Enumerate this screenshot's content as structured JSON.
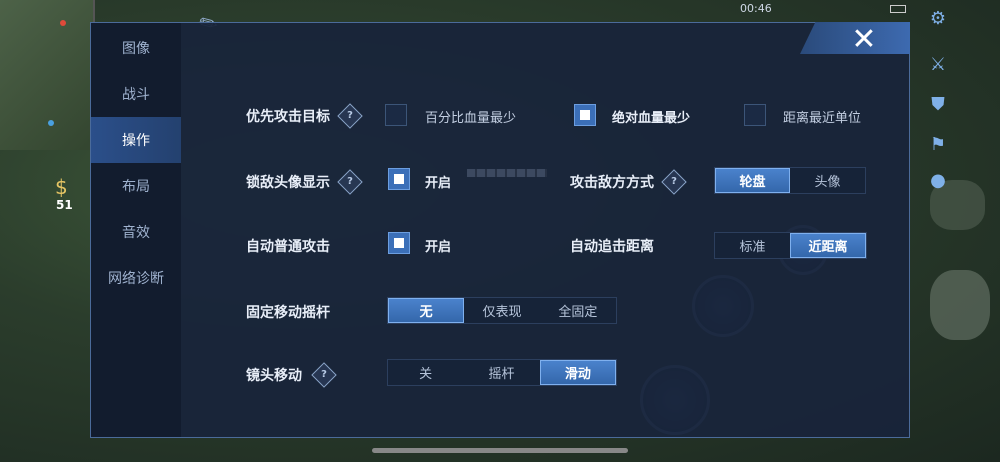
{
  "status": {
    "time": "00:46"
  },
  "hud": {
    "gold": "51"
  },
  "sidebar": {
    "items": [
      {
        "label": "图像"
      },
      {
        "label": "战斗"
      },
      {
        "label": "操作"
      },
      {
        "label": "布局"
      },
      {
        "label": "音效"
      },
      {
        "label": "网络诊断"
      }
    ],
    "active_index": 2
  },
  "close_icon": "close-icon",
  "settings": {
    "target_priority": {
      "label": "优先攻击目标",
      "options": [
        {
          "text": "百分比血量最少",
          "checked": false
        },
        {
          "text": "绝对血量最少",
          "checked": true
        },
        {
          "text": "距离最近单位",
          "checked": false
        }
      ]
    },
    "lock_avatar": {
      "label": "锁敌头像显示",
      "option": "开启",
      "checked": true
    },
    "attack_mode": {
      "label": "攻击敌方方式",
      "options": [
        "轮盘",
        "头像"
      ],
      "selected": 0
    },
    "auto_attack": {
      "label": "自动普通攻击",
      "option": "开启",
      "checked": true
    },
    "chase_distance": {
      "label": "自动追击距离",
      "options": [
        "标准",
        "近距离"
      ],
      "selected": 1
    },
    "joystick": {
      "label": "固定移动摇杆",
      "options": [
        "无",
        "仅表现",
        "全固定"
      ],
      "selected": 0
    },
    "camera": {
      "label": "镜头移动",
      "options": [
        "关",
        "摇杆",
        "滑动"
      ],
      "selected": 2
    }
  },
  "colors": {
    "accent": "#3b6fb8",
    "panel": "#18243a",
    "sidebar_active": "#2b4f8a"
  }
}
